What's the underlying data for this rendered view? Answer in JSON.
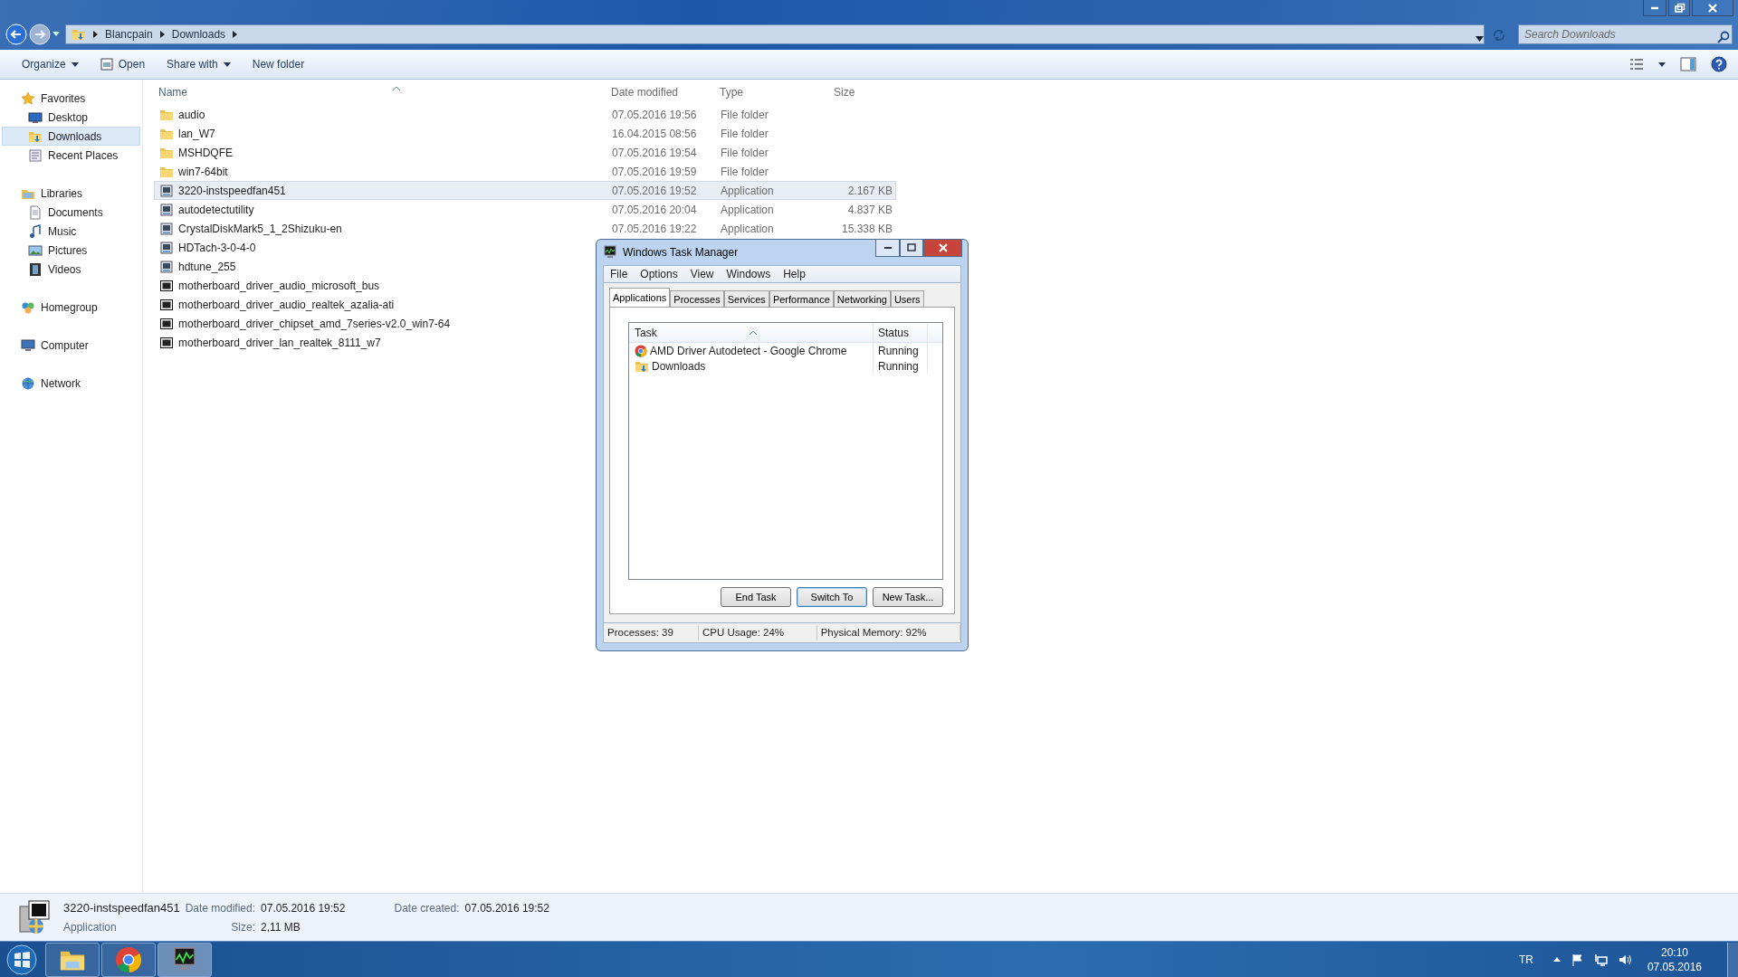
{
  "window": {
    "breadcrumb": [
      "Blancpain",
      "Downloads"
    ],
    "search": {
      "placeholder": "Search Downloads"
    }
  },
  "toolbar": [
    {
      "label": "Organize",
      "kind": "menu"
    },
    {
      "label": "Open",
      "kind": "icon"
    },
    {
      "label": "Share with",
      "kind": "menu"
    },
    {
      "label": "New folder",
      "kind": "plain"
    }
  ],
  "sidebar": [
    {
      "label": "Favorites",
      "kind": "star",
      "children": [
        {
          "label": "Desktop",
          "kind": "desktop",
          "selected": false
        },
        {
          "label": "Downloads",
          "kind": "downloads",
          "selected": true
        },
        {
          "label": "Recent Places",
          "kind": "recent",
          "selected": false
        }
      ]
    },
    {
      "label": "Libraries",
      "kind": "library",
      "children": [
        {
          "label": "Documents",
          "kind": "documents",
          "selected": false
        },
        {
          "label": "Music",
          "kind": "music",
          "selected": false
        },
        {
          "label": "Pictures",
          "kind": "pictures",
          "selected": false
        },
        {
          "label": "Videos",
          "kind": "videos",
          "selected": false
        }
      ]
    },
    {
      "label": "Homegroup",
      "kind": "homegroup"
    },
    {
      "label": "Computer",
      "kind": "computer"
    },
    {
      "label": "Network",
      "kind": "network"
    }
  ],
  "columns": [
    "Name",
    "Date modified",
    "Type",
    "Size"
  ],
  "files": [
    {
      "name": "audio",
      "kind": "folder",
      "date": "07.05.2016 19:56",
      "type": "File folder",
      "selected": false
    },
    {
      "name": "lan_W7",
      "kind": "folder",
      "date": "16.04.2015 08:56",
      "type": "File folder",
      "selected": false
    },
    {
      "name": "MSHDQFE",
      "kind": "folder",
      "date": "07.05.2016 19:54",
      "type": "File folder",
      "selected": false
    },
    {
      "name": "win7-64bit",
      "kind": "folder",
      "date": "07.05.2016 19:59",
      "type": "File folder",
      "selected": false
    },
    {
      "name": "3220-instspeedfan451",
      "kind": "app",
      "date": "07.05.2016 19:52",
      "type": "Application",
      "size": "2.167 KB",
      "selected": true
    },
    {
      "name": "autodetectutility",
      "kind": "app",
      "date": "07.05.2016 20:04",
      "type": "Application",
      "size": "4.837 KB",
      "selected": false
    },
    {
      "name": "CrystalDiskMark5_1_2Shizuku-en",
      "kind": "app",
      "date": "07.05.2016 19:22",
      "type": "Application",
      "size": "15.338 KB",
      "selected": false
    },
    {
      "name": "HDTach-3-0-4-0",
      "kind": "app",
      "selected": false
    },
    {
      "name": "hdtune_255",
      "kind": "app",
      "selected": false
    },
    {
      "name": "motherboard_driver_audio_microsoft_bus",
      "kind": "zip",
      "selected": false
    },
    {
      "name": "motherboard_driver_audio_realtek_azalia-ati",
      "kind": "zip",
      "selected": false
    },
    {
      "name": "motherboard_driver_chipset_amd_7series-v2.0_win7-64",
      "kind": "zip",
      "selected": false
    },
    {
      "name": "motherboard_driver_lan_realtek_8111_w7",
      "kind": "zip",
      "selected": false
    }
  ],
  "details": {
    "name": "3220-instspeedfan451",
    "type": "Application",
    "fields": [
      {
        "label": "Date modified:",
        "value": "07.05.2016 19:52"
      },
      {
        "label": "Size:",
        "value": "2,11 MB"
      },
      {
        "label": "Date created:",
        "value": "07.05.2016 19:52"
      }
    ]
  },
  "task_manager": {
    "title": "Windows Task Manager",
    "menu": [
      "File",
      "Options",
      "View",
      "Windows",
      "Help"
    ],
    "tabs": [
      {
        "label": "Applications",
        "selected": true
      },
      {
        "label": "Processes",
        "selected": false
      },
      {
        "label": "Services",
        "selected": false
      },
      {
        "label": "Performance",
        "selected": false
      },
      {
        "label": "Networking",
        "selected": false
      },
      {
        "label": "Users",
        "selected": false
      }
    ],
    "columns": [
      "Task",
      "Status"
    ],
    "tasks": [
      {
        "name": "AMD Driver Autodetect - Google Chrome",
        "kind": "chrome",
        "status": "Running"
      },
      {
        "name": "Downloads",
        "kind": "downloads",
        "status": "Running"
      }
    ],
    "buttons": [
      {
        "label": "End Task",
        "focused": false
      },
      {
        "label": "Switch To",
        "focused": true
      },
      {
        "label": "New Task...",
        "focused": false
      }
    ],
    "status_bar": [
      "Processes: 39",
      "CPU Usage: 24%",
      "Physical Memory: 92%"
    ]
  },
  "taskbar": {
    "apps": [
      {
        "kind": "explorer",
        "active": false
      },
      {
        "kind": "chrome",
        "active": false
      },
      {
        "kind": "taskmgr",
        "active": true
      }
    ],
    "language": "TR",
    "time": "20:10",
    "date": "07.05.2016"
  }
}
